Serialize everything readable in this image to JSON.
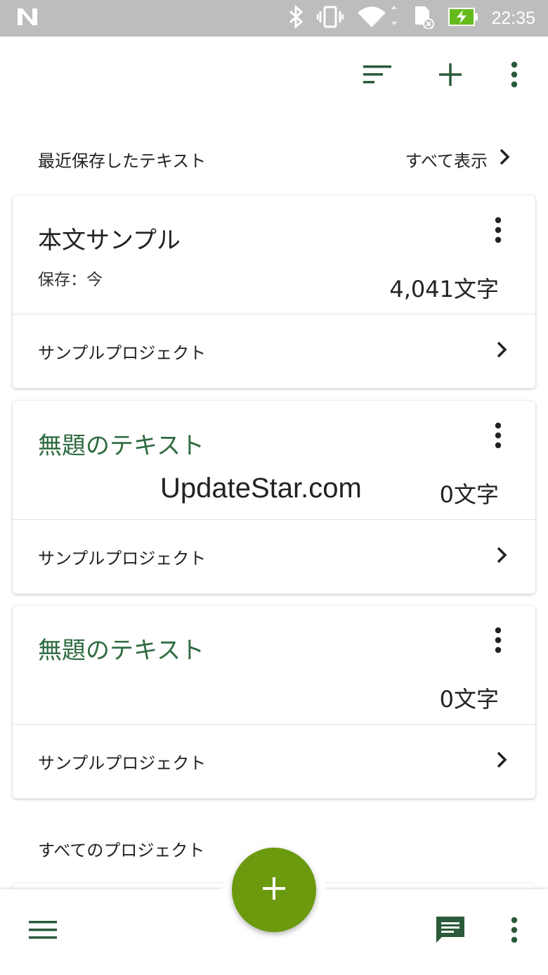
{
  "status_bar": {
    "time": "22:35"
  },
  "toolbar": {
    "sort_icon": "sort-icon",
    "add_icon": "plus-icon",
    "more_icon": "more-vert-icon"
  },
  "recent": {
    "heading": "最近保存したテキスト",
    "show_all": "すべて表示"
  },
  "cards": [
    {
      "title": "本文サンプル",
      "saved": "保存：今",
      "count": "4,041文字",
      "project": "サンプルプロジェクト"
    },
    {
      "title": "無題のテキスト",
      "saved": "",
      "count": "0文字",
      "project": "サンプルプロジェクト"
    },
    {
      "title": "無題のテキスト",
      "saved": "",
      "count": "0文字",
      "project": "サンプルプロジェクト"
    }
  ],
  "projects": {
    "heading": "すべてのプロジェクト"
  },
  "watermark": "UpdateStar.com",
  "colors": {
    "accent": "#2e6b3f",
    "fab": "#6b9a0e",
    "status_bar": "#bdbdbd"
  }
}
